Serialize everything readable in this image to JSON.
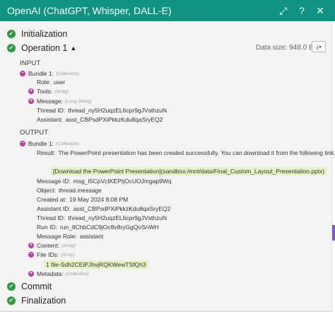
{
  "window": {
    "title": "OpenAI (ChatGPT, Whisper, DALL-E)",
    "buttons": [
      "expand-icon",
      "help-icon",
      "close-icon"
    ]
  },
  "operations": {
    "initialization": "Initialization",
    "operation": "Operation 1",
    "commit": "Commit",
    "finalization": "Finalization",
    "data_size": "Data size: 948.0 B"
  },
  "input": {
    "heading": "INPUT",
    "bundle_label": "Bundle 1:",
    "bundle_type": "(Collection)",
    "role_key": "Role:",
    "role_value": "user",
    "tools_key": "Tools:",
    "tools_type": "(Array)",
    "message_key": "Message:",
    "message_type": "(Long String)",
    "thread_key": "Thread ID:",
    "thread_value": "thread_ny5H2uqzEL6cpr9gJVsthzuN",
    "assistant_key": "Assistant:",
    "assistant_value": "asst_CBPsdPXiPkkzKdu8qaSryEQ2"
  },
  "output": {
    "heading": "OUTPUT",
    "bundle_label": "Bundle 1:",
    "bundle_type": "(Collection)",
    "result_key": "Result:",
    "result_value": "The PowerPoint presentation has been created successfully. You can download it from the following link:",
    "result_link": "[Download the PowerPoint Presentation](sandbox:/mnt/data/Final_Custom_Layout_Presentation.pptx)",
    "message_id_key": "Message ID:",
    "message_id_value": "msg_I5CpVcIKEPIjOcUOJmgap9Wq",
    "object_key": "Object:",
    "object_value": "thread.message",
    "created_key": "Created at:",
    "created_value": "19 May 2024 8:08 PM",
    "assistant_id_key": "Assistant ID:",
    "assistant_id_value": "asst_CBPsdPXiPkkzKdu8qaSryEQ2",
    "thread_key": "Thread ID:",
    "thread_value": "thread_ny5H2uqzEL6cpr9gJVsthzuN",
    "run_key": "Run ID:",
    "run_value": "run_8ChbCdC9jOc8v8ryGgQoSnWH",
    "role_key": "Message Role:",
    "role_value": "assistant",
    "content_key": "Content:",
    "content_type": "(Array)",
    "file_ids_key": "File IDs:",
    "file_ids_type": "(Array)",
    "file_id_index": "1",
    "file_id_value": "file-Sdh2CEiPJhvjRQKWewTSfQh3",
    "metadata_key": "Metadata:",
    "metadata_type": "(Collection)"
  },
  "colors": {
    "titlebar": "#0e9481",
    "check": "#2d9d3a",
    "toggle": "#c13aa0",
    "highlight": "#e6f2c4"
  }
}
